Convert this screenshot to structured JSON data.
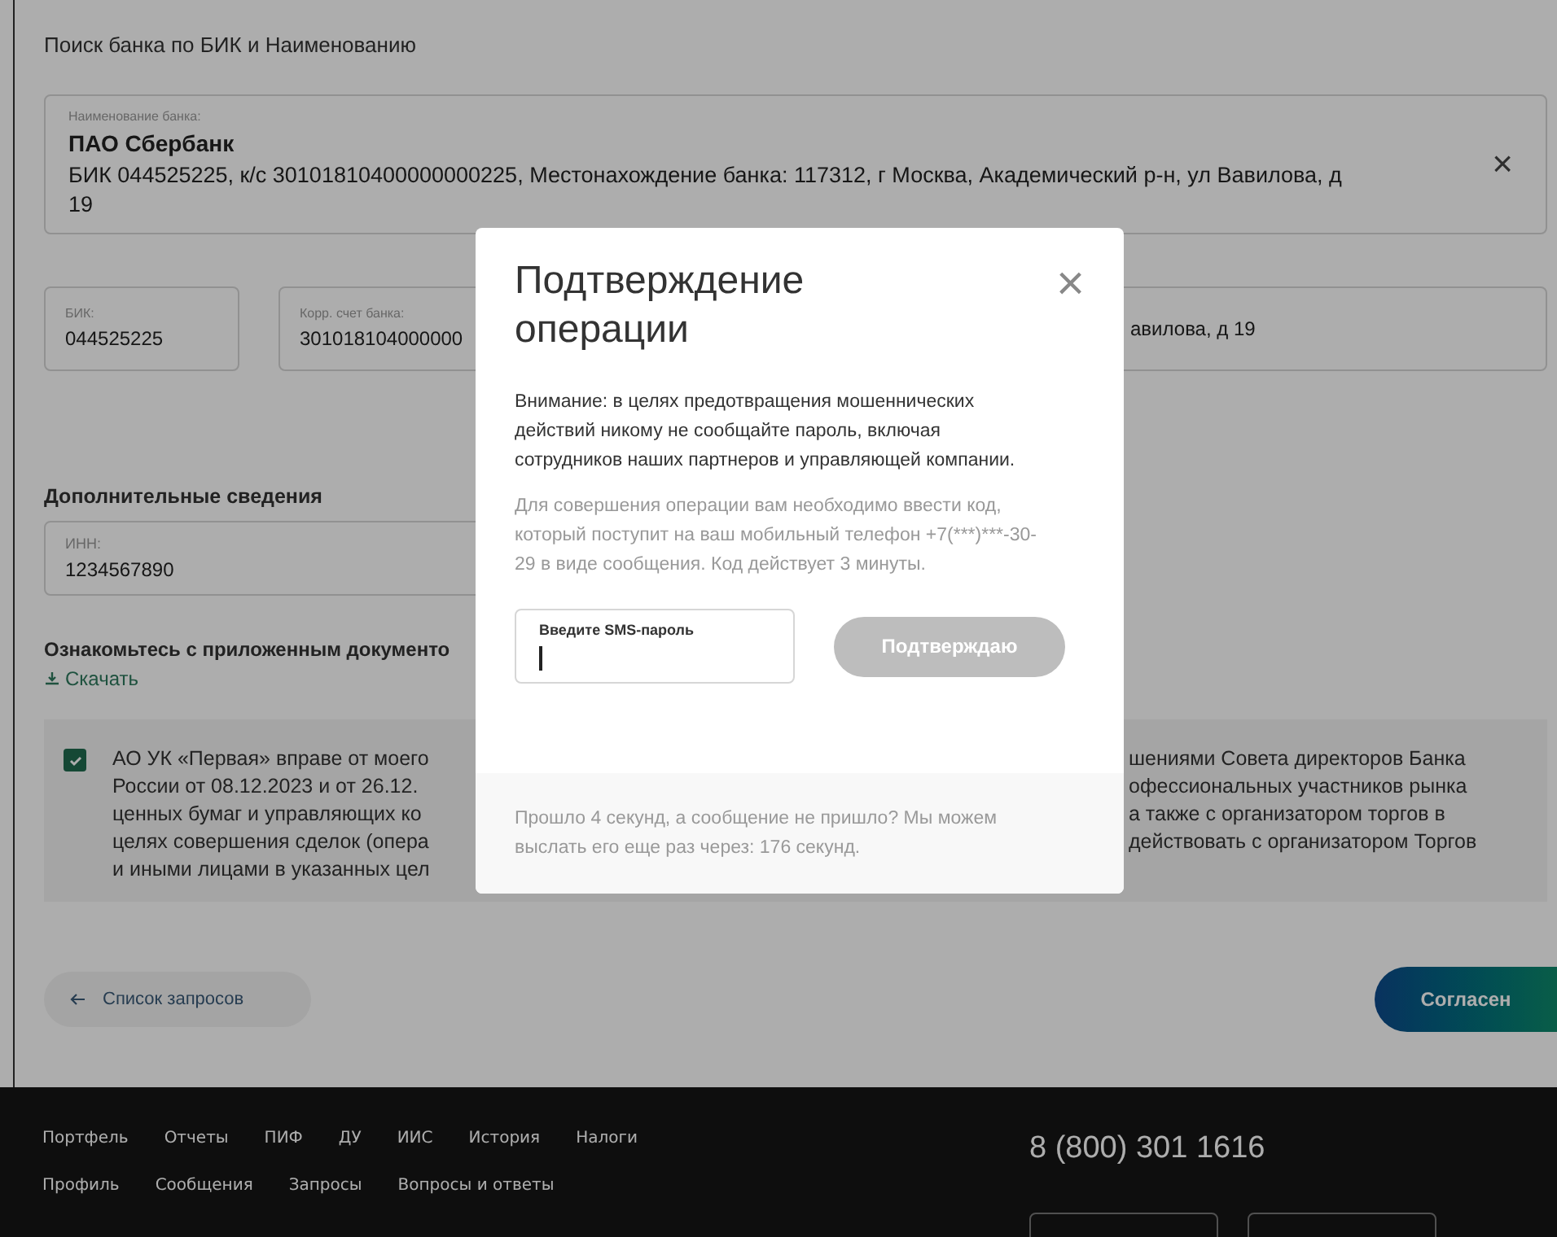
{
  "page": {
    "title": "Поиск банка по БИК и Наименованию",
    "bank": {
      "label": "Наименование банка:",
      "name": "ПАО Сбербанк",
      "details": "БИК 044525225, к/с 30101810400000000225, Местонахождение банка: 117312, г Москва, Академический р-н, ул Вавилова, д 19",
      "clear": "×"
    },
    "fields": [
      {
        "label": "БИК:",
        "value": "044525225"
      },
      {
        "label": "Корр. счет банка:",
        "value": "301018104000000"
      },
      {
        "value": "авилова, д 19"
      }
    ],
    "extra_title": "Дополнительные сведения",
    "inn": {
      "label": "ИНН:",
      "value": "1234567890"
    },
    "docs_title": "Ознакомьтесь с приложенным документо",
    "download": "Скачать",
    "consent": {
      "checked": true,
      "lines_left": [
        "АО УК «Первая» вправе от моего",
        "России от 08.12.2023 и от 26.12.",
        "ценных бумаг и управляющих ко",
        "целях совершения сделок (опера",
        "и иными лицами в указанных цел"
      ],
      "lines_right": [
        "шениями Совета директоров Банка",
        "офессиональных участников рынка",
        "а также с организатором торгов в",
        "действовать с организатором Торгов"
      ]
    },
    "back_button": "Список запросов",
    "agree_button": "Согласен"
  },
  "modal": {
    "title": "Подтверждение операции",
    "close": "×",
    "warning": "Внимание: в целях предотвращения мошеннических действий никому не сообщайте пароль, включая сотрудников наших партнеров и управляющей компании.",
    "info": "Для совершения операции вам необходимо ввести код, который поступит на ваш мобильный телефон +7(***)***-30-29 в виде сообщения. Код действует 3 минуты.",
    "sms_field": {
      "label": "Введите SMS-пароль",
      "focused": true
    },
    "confirm": {
      "label": "Подтверждаю",
      "disabled": true
    },
    "resend": "Прошло 4 секунд, а сообщение не пришло? Мы можем выслать его еще раз через: 176 секунд."
  },
  "footer": {
    "links_row1": [
      "Портфель",
      "Отчеты",
      "ПИФ",
      "ДУ",
      "ИИС",
      "История",
      "Налоги"
    ],
    "links_row2": [
      "Профиль",
      "Сообщения",
      "Запросы",
      "Вопросы и ответы"
    ],
    "phone": "8 (800) 301 1616",
    "buttons": [
      {
        "kind": "outline"
      },
      {
        "kind": "outline"
      }
    ]
  }
}
